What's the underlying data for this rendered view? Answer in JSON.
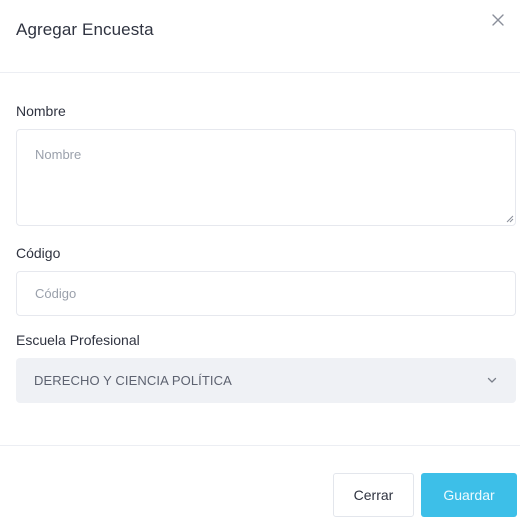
{
  "modal": {
    "title": "Agregar Encuesta",
    "close_icon": "close-icon"
  },
  "form": {
    "nombre": {
      "label": "Nombre",
      "placeholder": "Nombre",
      "value": ""
    },
    "codigo": {
      "label": "Código",
      "placeholder": "Código",
      "value": ""
    },
    "escuela": {
      "label": "Escuela Profesional",
      "selected": "DERECHO Y CIENCIA POLÍTICA",
      "icon": "chevron-down-icon"
    }
  },
  "footer": {
    "cancel_label": "Cerrar",
    "save_label": "Guardar"
  },
  "colors": {
    "accent": "#3dbfe8",
    "select_bg": "#eff1f5",
    "border": "#e6e8ee"
  }
}
